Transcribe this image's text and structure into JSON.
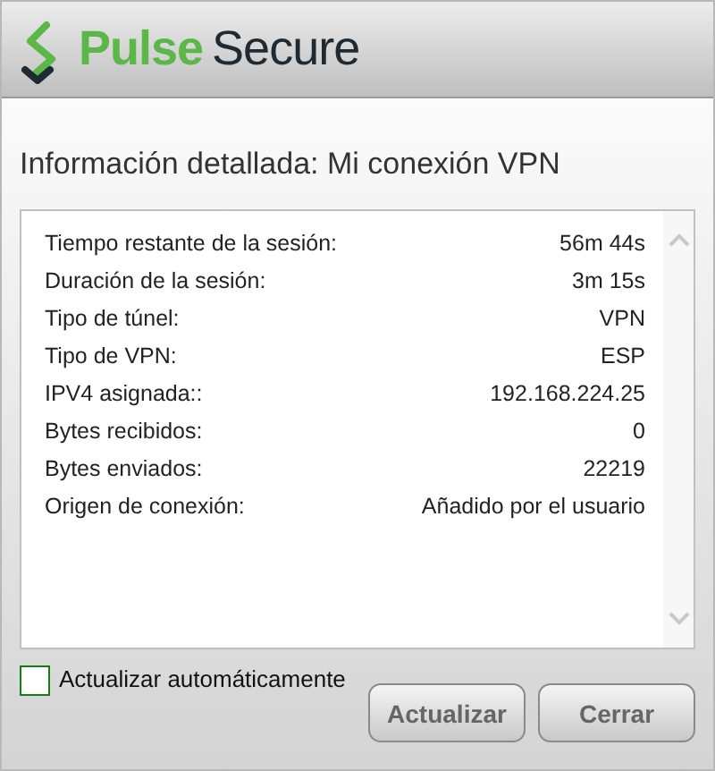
{
  "header": {
    "brand_primary": "Pulse",
    "brand_secondary": "Secure"
  },
  "title": "Información detallada: Mi conexión VPN",
  "details": [
    {
      "label": "Tiempo restante de la sesión:",
      "value": "56m 44s"
    },
    {
      "label": "Duración de la sesión:",
      "value": "3m 15s"
    },
    {
      "label": "Tipo de túnel:",
      "value": "VPN"
    },
    {
      "label": "Tipo de VPN:",
      "value": "ESP"
    },
    {
      "label": "IPV4 asignada::",
      "value": "192.168.224.25"
    },
    {
      "label": "Bytes recibidos:",
      "value": "0"
    },
    {
      "label": "Bytes enviados:",
      "value": "22219"
    },
    {
      "label": "Origen de conexión:",
      "value": "Añadido por el usuario"
    }
  ],
  "auto_refresh": {
    "label": "Actualizar automáticamente",
    "checked": false
  },
  "buttons": [
    "Actualizar",
    "Cerrar"
  ]
}
